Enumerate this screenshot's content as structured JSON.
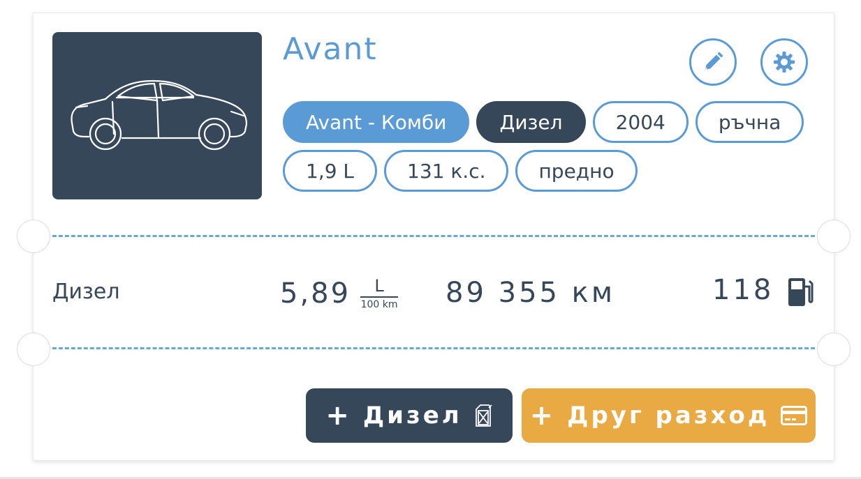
{
  "vehicle": {
    "name": "Avant",
    "image_icon": "car-sedan-icon",
    "tags_row1": [
      "Avant - Комби",
      "Дизел",
      "2004",
      "ръчна"
    ],
    "tags_row2": [
      "1,9 L",
      "131 к.с.",
      "предно"
    ]
  },
  "actions_top": {
    "edit_icon": "pencil-icon",
    "settings_icon": "gear-icon"
  },
  "stats": {
    "fuel_label": "Дизел",
    "consumption": "5,89",
    "consumption_unit_top": "L",
    "consumption_unit_bottom": "100 km",
    "mileage": "89 355 км",
    "refuel_count": "118",
    "refuel_icon": "fuel-pump-icon"
  },
  "buttons": {
    "add_fuel": "Дизел",
    "add_fuel_icon": "jerrycan-icon",
    "add_expense": "Друг разход",
    "add_expense_icon": "credit-card-icon"
  },
  "colors": {
    "accent_blue": "#5b9bd5",
    "dark": "#36475a",
    "orange": "#e9a943"
  }
}
